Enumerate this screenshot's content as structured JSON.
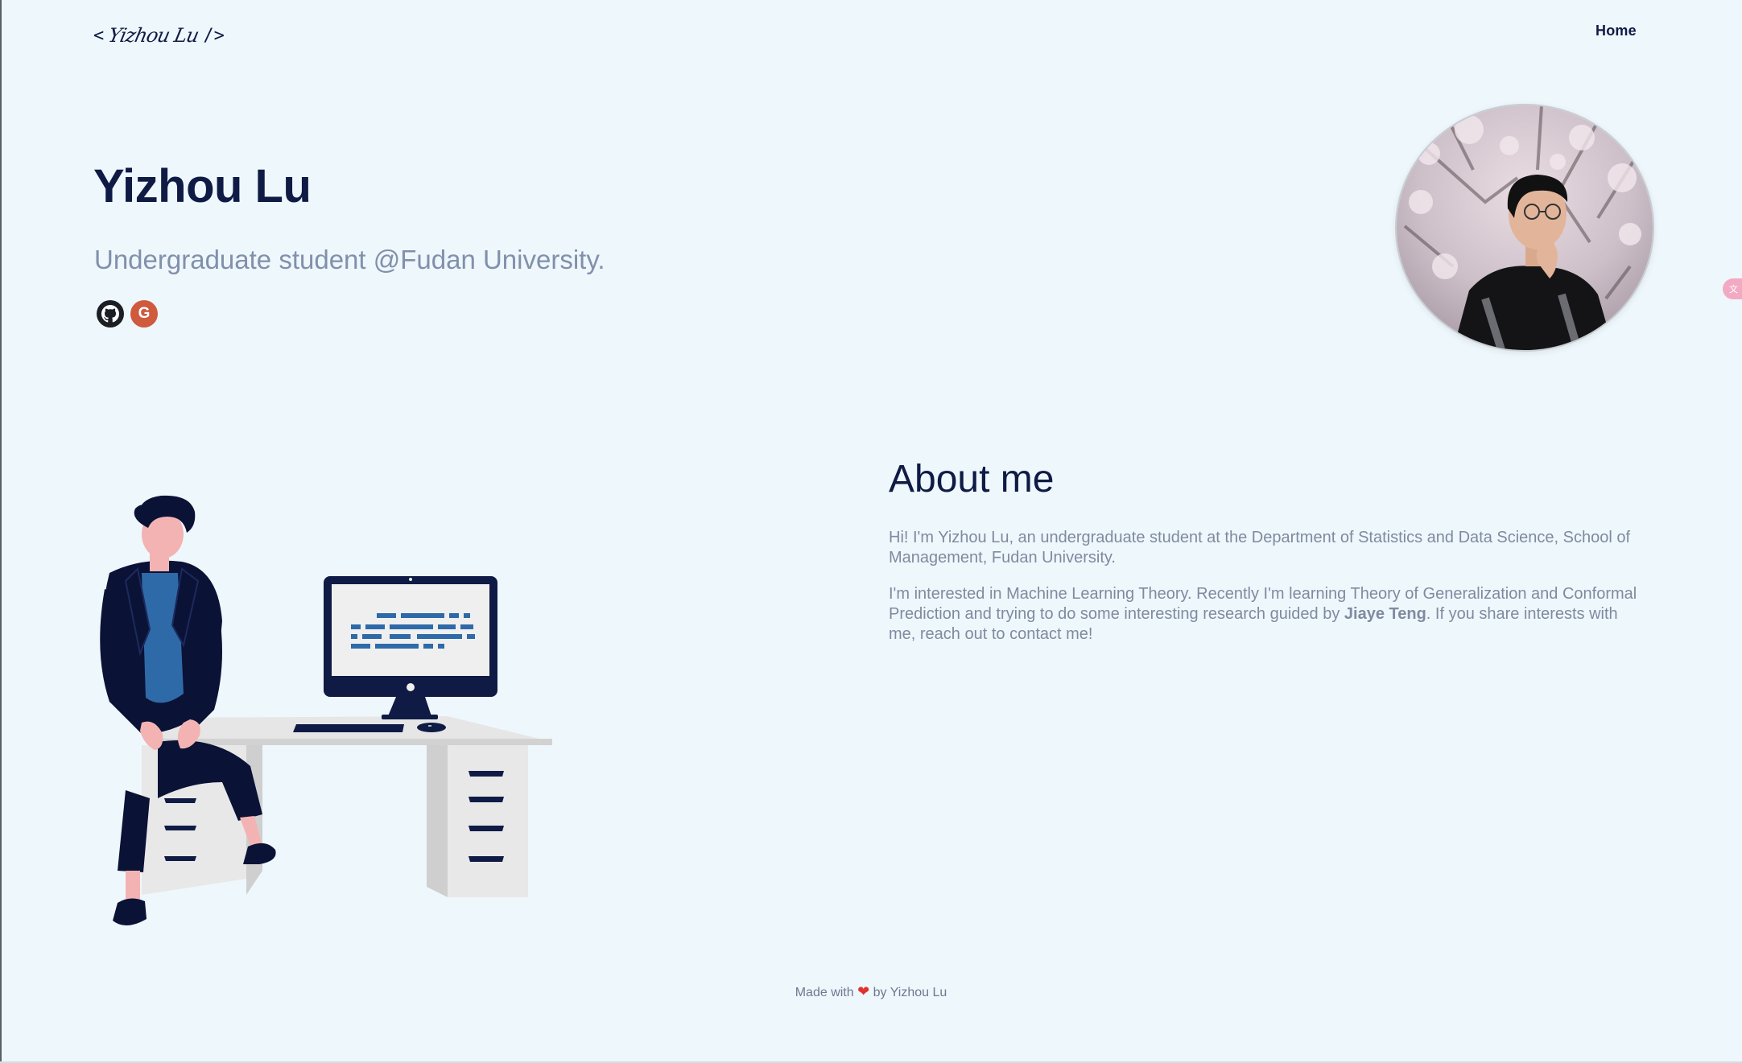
{
  "header": {
    "logo": {
      "open": "<",
      "signature": "Yizhou Lu",
      "close": "/>"
    },
    "nav": {
      "home": "Home"
    }
  },
  "hero": {
    "name": "Yizhou Lu",
    "subtitle": "Undergraduate student @Fudan University.",
    "social": [
      {
        "name": "GitHub",
        "icon": "github-icon",
        "color": "#1b1f23"
      },
      {
        "name": "Google Scholar",
        "icon": "google-scholar-icon",
        "color": "#cf5a3e",
        "glyph": "G"
      }
    ]
  },
  "about": {
    "title": "About me",
    "p1": "Hi! I'm Yizhou Lu, an undergraduate student at the Department of Statistics and Data Science, School of Management, Fudan University.",
    "p2_before": "I'm interested in Machine Learning Theory. Recently I'm learning Theory of Generalization and Conformal Prediction and trying to do some interesting research guided by ",
    "p2_link": "Jiaye Teng",
    "p2_after": ". If you share interests with me, reach out to contact me!"
  },
  "footer": {
    "before": "Made with",
    "heart": "❤",
    "after": "by Yizhou Lu"
  },
  "colors": {
    "background": "#eef7fc",
    "navy": "#0f1b45",
    "muted": "#808a9f",
    "accent_blue": "#2f6aa8"
  }
}
